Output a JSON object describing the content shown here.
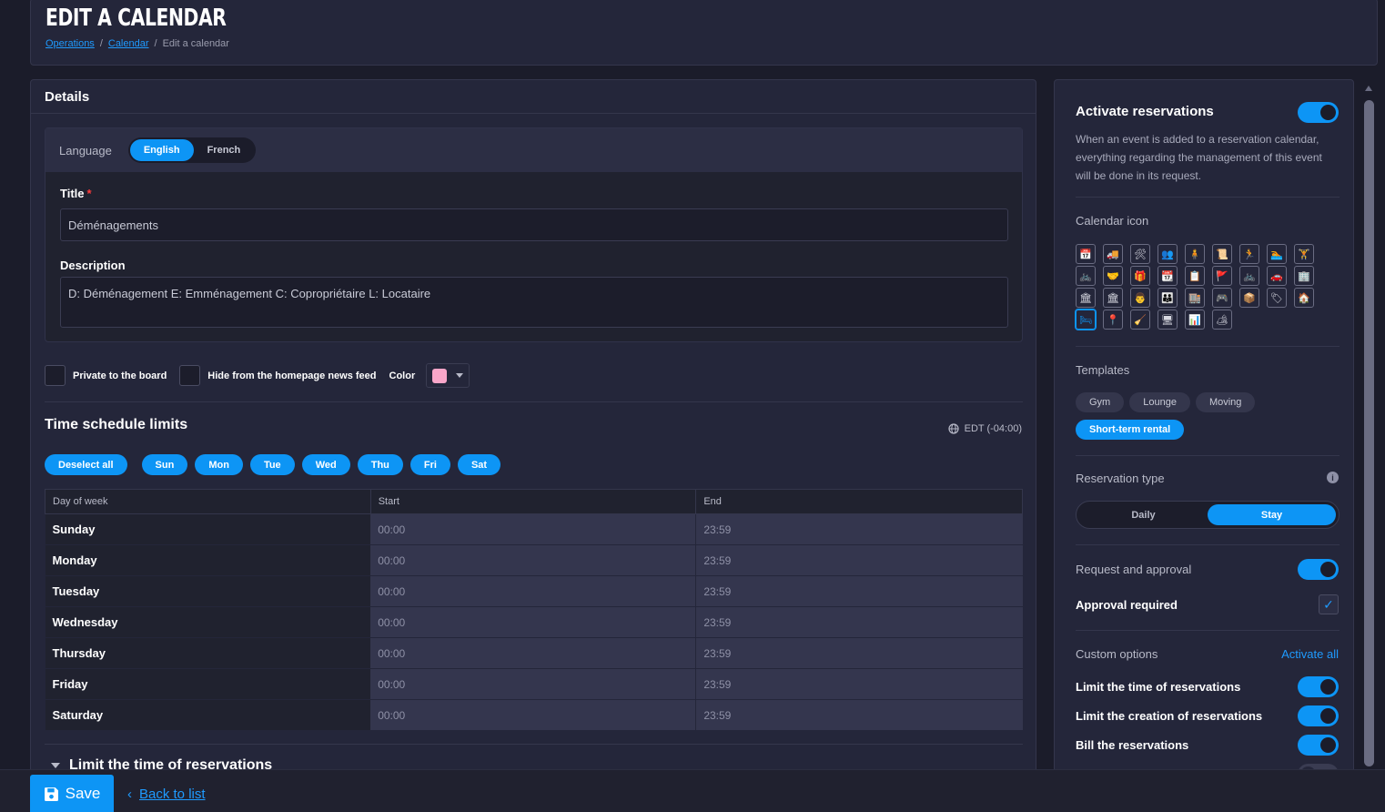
{
  "page": {
    "title": "EDIT A CALENDAR",
    "breadcrumb": [
      "Operations",
      "Calendar",
      "Edit a calendar"
    ]
  },
  "details": {
    "heading": "Details",
    "language_label": "Language",
    "languages": [
      "English",
      "French"
    ],
    "selected_language": "English",
    "title_label": "Title",
    "title_value": "Déménagements",
    "description_label": "Description",
    "description_value": "D: Déménagement  E: Emménagement  C: Copropriétaire  L: Locataire",
    "private_label": "Private to the board",
    "hide_label": "Hide from the homepage news feed",
    "color_label": "Color",
    "color_value": "#f9a6c9"
  },
  "schedule": {
    "heading": "Time schedule limits",
    "timezone": "EDT (-04:00)",
    "deselect_label": "Deselect all",
    "day_buttons": [
      "Sun",
      "Mon",
      "Tue",
      "Wed",
      "Thu",
      "Fri",
      "Sat"
    ],
    "columns": [
      "Day of week",
      "Start",
      "End"
    ],
    "rows": [
      {
        "day": "Sunday",
        "start": "00:00",
        "end": "23:59"
      },
      {
        "day": "Monday",
        "start": "00:00",
        "end": "23:59"
      },
      {
        "day": "Tuesday",
        "start": "00:00",
        "end": "23:59"
      },
      {
        "day": "Wednesday",
        "start": "00:00",
        "end": "23:59"
      },
      {
        "day": "Thursday",
        "start": "00:00",
        "end": "23:59"
      },
      {
        "day": "Friday",
        "start": "00:00",
        "end": "23:59"
      },
      {
        "day": "Saturday",
        "start": "00:00",
        "end": "23:59"
      }
    ],
    "collapsed_section": "Limit the time of reservations"
  },
  "sidebar": {
    "activate_title": "Activate reservations",
    "activate_on": true,
    "activate_text": "When an event is added to a reservation calendar, everything regarding the management of this event will be done in its request.",
    "icon_label": "Calendar icon",
    "icons": [
      "📅",
      "🚚",
      "🛠",
      "👥",
      "🧍",
      "📜",
      "🏃",
      "🏊",
      "🏋",
      "🚲",
      "🤝",
      "🎁",
      "📆",
      "📋",
      "🚩",
      "🚲",
      "🚗",
      "🏢",
      "🏛",
      "🏛",
      "👨",
      "👪",
      "🏬",
      "🎮",
      "📦",
      "🏷",
      "🏠",
      "🛏",
      "📍",
      "🧹",
      "🖥",
      "📊",
      "🏕"
    ],
    "selected_icon_index": 27,
    "templates_label": "Templates",
    "templates": [
      "Gym",
      "Lounge",
      "Moving",
      "Short-term rental"
    ],
    "selected_template": "Short-term rental",
    "reservation_type_label": "Reservation type",
    "reservation_types": [
      "Daily",
      "Stay"
    ],
    "selected_reservation_type": "Stay",
    "request_label": "Request and approval",
    "request_on": true,
    "approval_label": "Approval required",
    "approval_checked": true,
    "custom_label": "Custom options",
    "activate_all": "Activate all",
    "custom_options": [
      {
        "label": "Limit the time of reservations",
        "on": true
      },
      {
        "label": "Limit the creation of reservations",
        "on": true
      },
      {
        "label": "Bill the reservations",
        "on": true
      }
    ]
  },
  "footer": {
    "save_label": "Save",
    "back_label": "Back to list"
  }
}
